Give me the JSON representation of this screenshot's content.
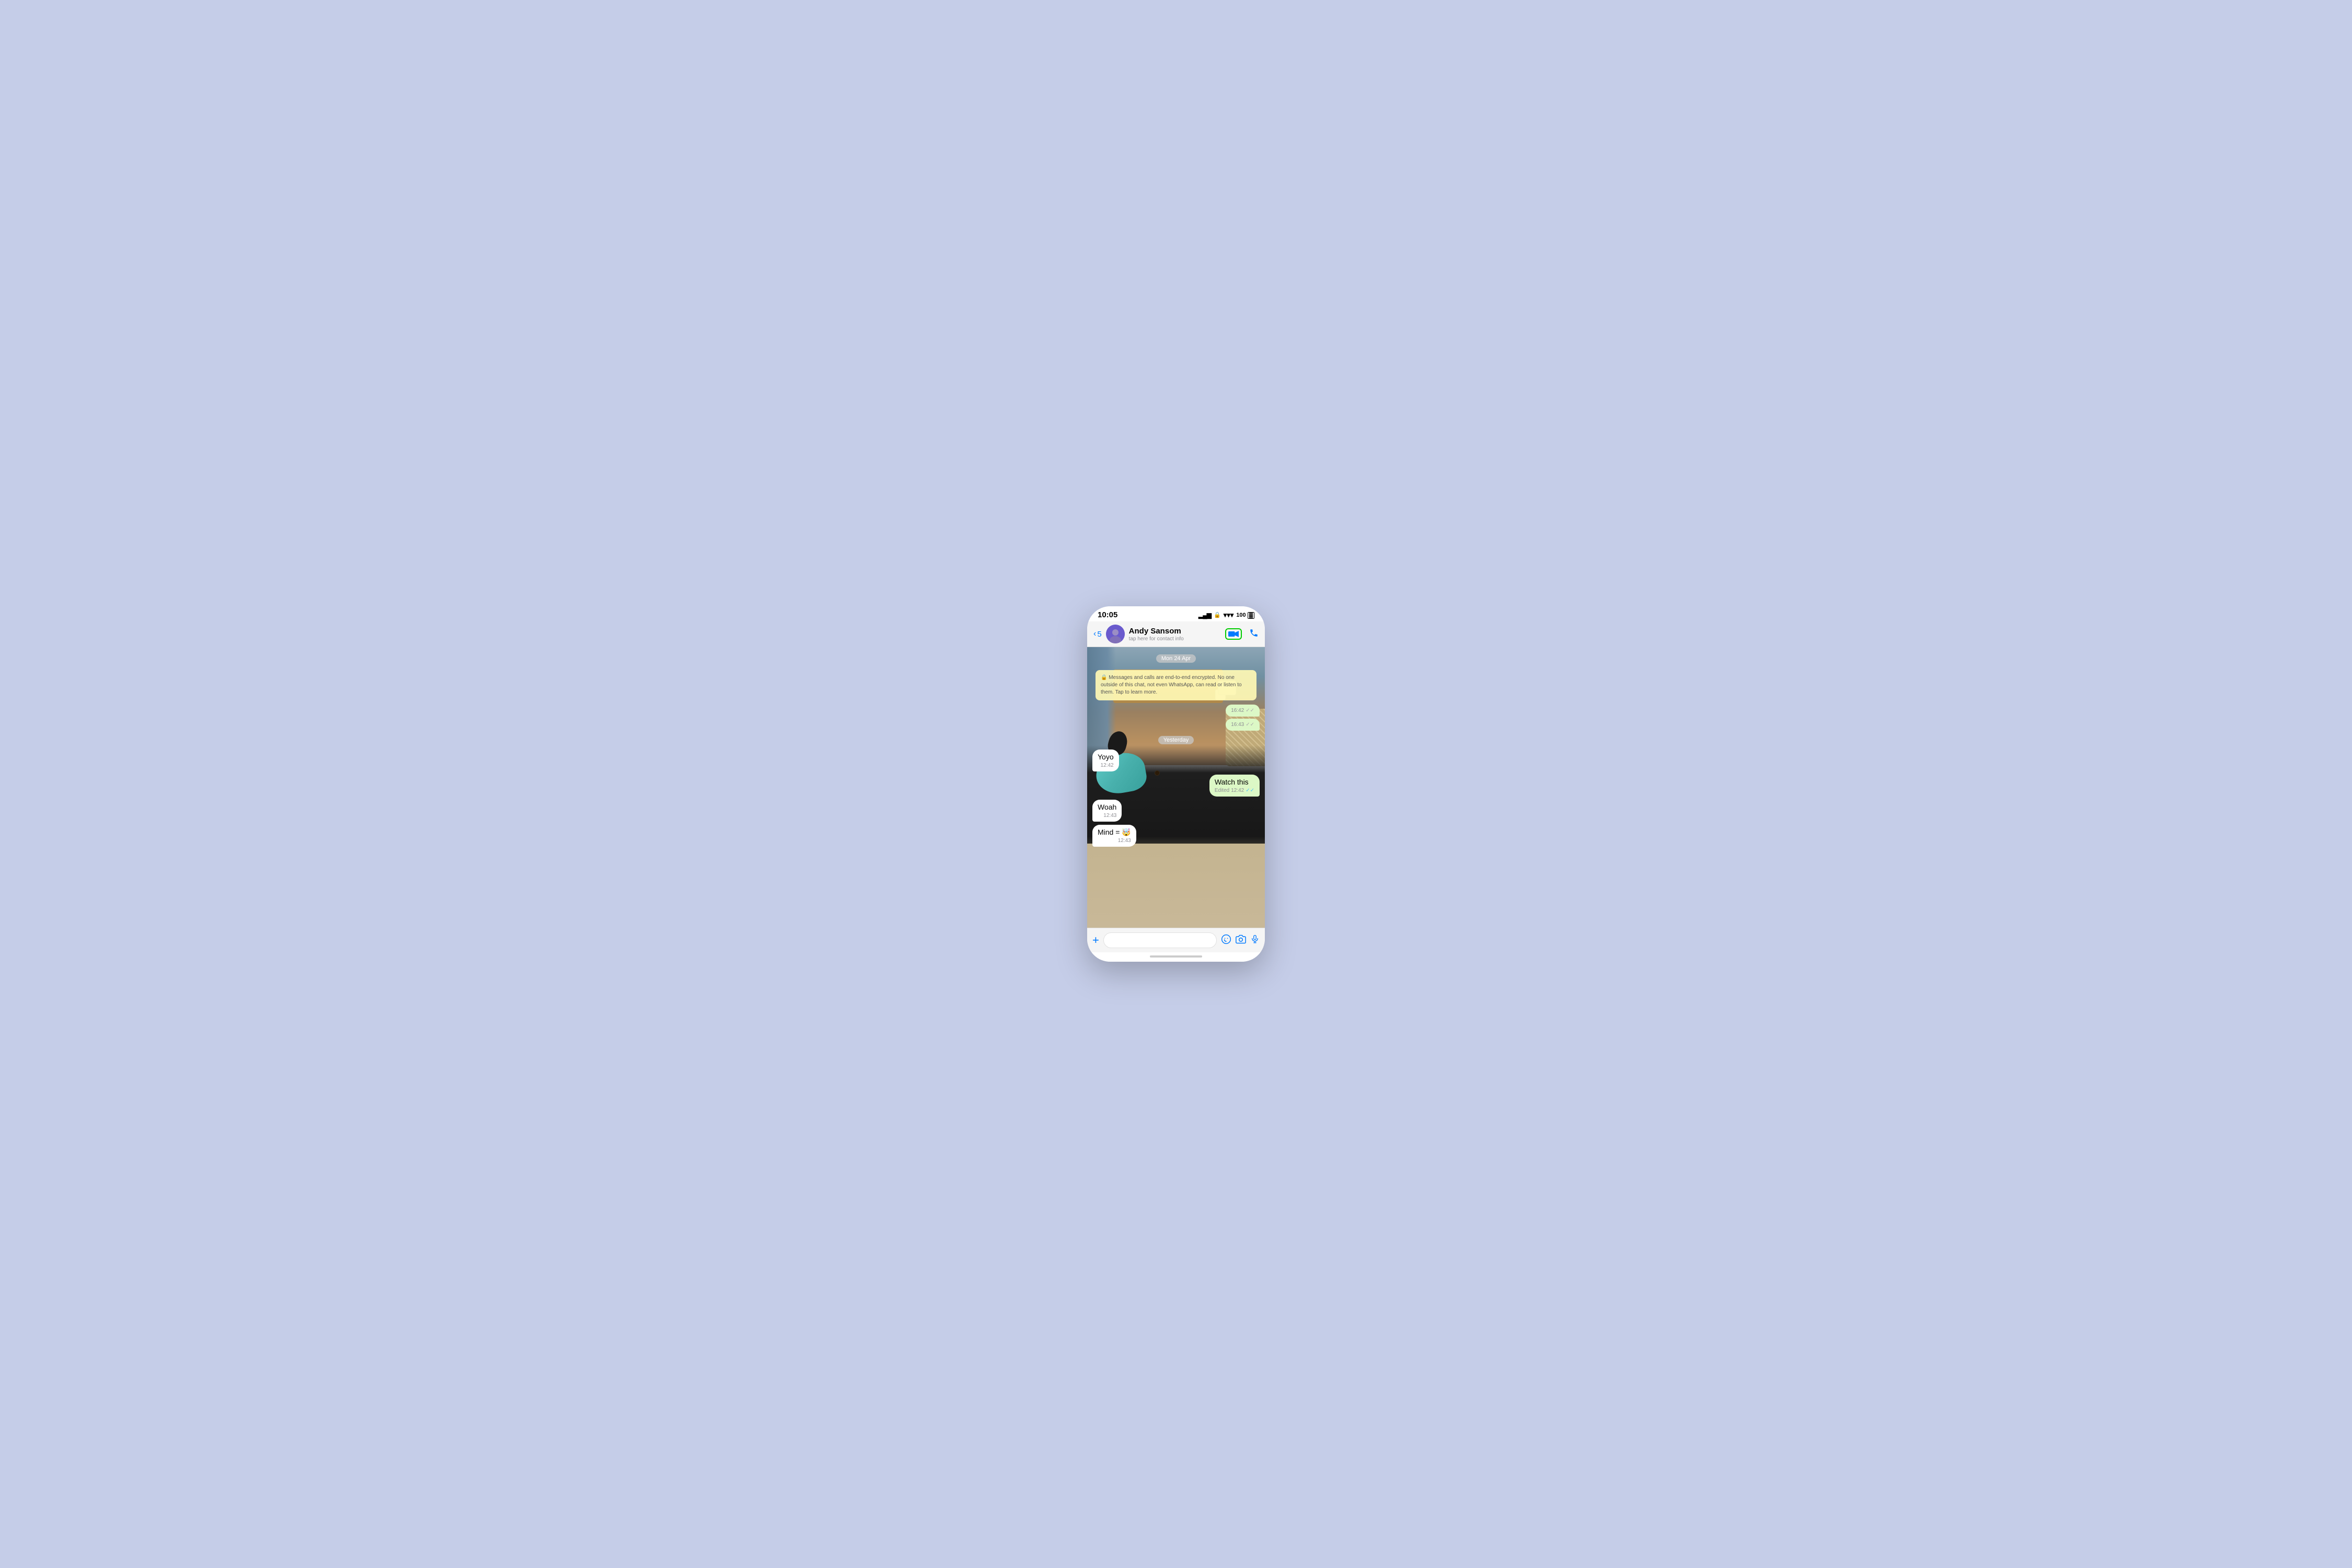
{
  "statusBar": {
    "time": "10:05",
    "batteryLabel": "100",
    "signalIcon": "signal-icon",
    "wifiIcon": "wifi-icon",
    "batteryIcon": "battery-icon"
  },
  "navBar": {
    "backCount": "5",
    "contactName": "Andy Sansom",
    "contactSubtitle": "tap here for contact info",
    "videoCallLabel": "video-call",
    "phoneCallLabel": "phone-call"
  },
  "chat": {
    "dateBadge1": "Mon 24 Apr",
    "encryptionNotice": "🔒 Messages and calls are end-to-end encrypted. No one outside of this chat, not even WhatsApp, can read or listen to them. Tap to learn more.",
    "sentMsg1Time": "16:42",
    "sentMsg2Time": "16:43",
    "dateBadge2": "Yesterday",
    "receivedMsg1": {
      "text": "Yoyo",
      "time": "12:42"
    },
    "sentMsg3": {
      "text": "Watch this",
      "edited": "Edited",
      "time": "12:42"
    },
    "receivedMsg2": {
      "text": "Woah",
      "time": "12:43"
    },
    "receivedMsg3": {
      "text": "Mind = 🤯",
      "time": "12:43"
    }
  },
  "inputBar": {
    "placeholder": "",
    "plusLabel": "+",
    "stickerIcon": "sticker-icon",
    "cameraIcon": "camera-icon",
    "micIcon": "mic-icon"
  }
}
